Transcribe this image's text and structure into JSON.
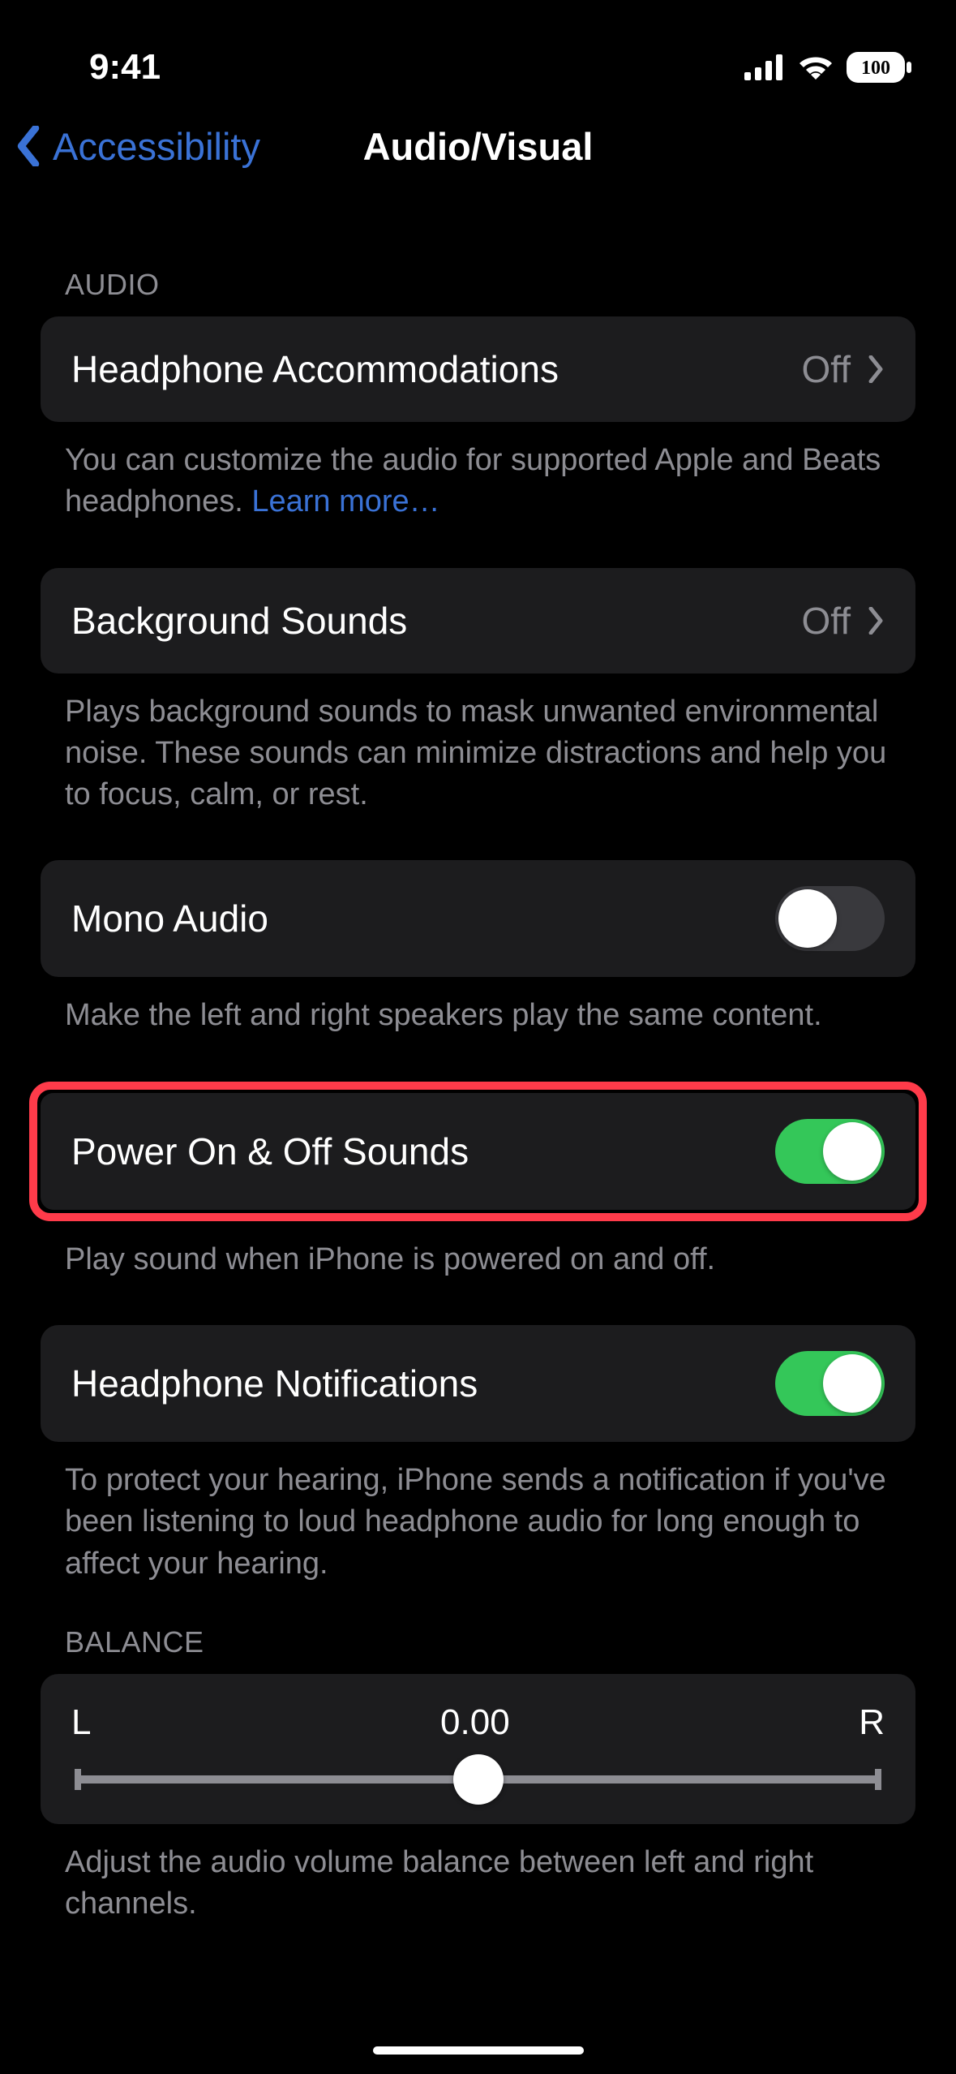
{
  "statusBar": {
    "time": "9:41",
    "battery": "100"
  },
  "nav": {
    "back": "Accessibility",
    "title": "Audio/Visual"
  },
  "sections": {
    "audioHeader": "AUDIO",
    "balanceHeader": "BALANCE"
  },
  "cells": {
    "headphoneAccommodations": {
      "label": "Headphone Accommodations",
      "value": "Off",
      "footer": "You can customize the audio for supported Apple and Beats headphones. ",
      "learnMore": "Learn more…"
    },
    "backgroundSounds": {
      "label": "Background Sounds",
      "value": "Off",
      "footer": "Plays background sounds to mask unwanted environmental noise. These sounds can minimize distractions and help you to focus, calm, or rest."
    },
    "monoAudio": {
      "label": "Mono Audio",
      "footer": "Make the left and right speakers play the same content."
    },
    "powerSounds": {
      "label": "Power On & Off Sounds",
      "footer": "Play sound when iPhone is powered on and off."
    },
    "headphoneNotifications": {
      "label": "Headphone Notifications",
      "footer": "To protect your hearing, iPhone sends a notification if you've been listening to loud headphone audio for long enough to affect your hearing."
    }
  },
  "balance": {
    "left": "L",
    "value": "0.00",
    "right": "R",
    "footer": "Adjust the audio volume balance between left and right channels."
  }
}
